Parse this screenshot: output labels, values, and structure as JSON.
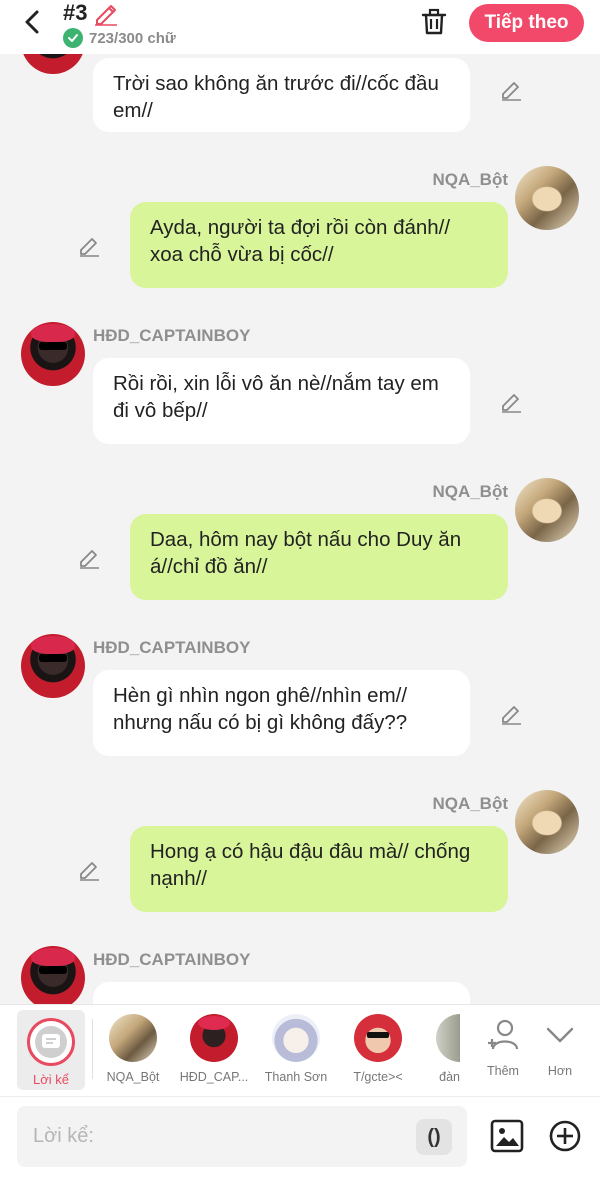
{
  "header": {
    "chapter": "#3",
    "word_count": "723/300 chữ",
    "next_label": "Tiếp theo"
  },
  "messages": [
    {
      "side": "left",
      "name": "",
      "text": "Trời sao không ăn trước đi//cốc đầu em//"
    },
    {
      "side": "right",
      "name": "NQA_Bột",
      "text": "Ayda, người ta đợi rồi còn đánh// xoa chỗ vừa bị cốc//"
    },
    {
      "side": "left",
      "name": "HĐD_CAPTAINBOY",
      "text": "Rồi rồi, xin lỗi vô ăn nè//nắm tay em đi vô bếp//"
    },
    {
      "side": "right",
      "name": "NQA_Bột",
      "text": "Daa, hôm nay bột nấu cho Duy ăn á//chỉ đồ ăn//"
    },
    {
      "side": "left",
      "name": "HĐD_CAPTAINBOY",
      "text": "Hèn gì nhìn ngon ghê//nhìn em// nhưng nấu có bị gì không đấy??"
    },
    {
      "side": "right",
      "name": "NQA_Bột",
      "text": "Hong ạ có hậu đậu đâu mà// chống nạnh//"
    },
    {
      "side": "left",
      "name": "HĐD_CAPTAINBOY",
      "text": ""
    }
  ],
  "charbar": {
    "narration_label": "Lời kể",
    "characters": [
      {
        "label": "NQA_Bột",
        "avatar": "nqa"
      },
      {
        "label": "HĐD_CAP...",
        "avatar": "hdd"
      },
      {
        "label": "Thanh Sơn",
        "avatar": "ts"
      },
      {
        "label": "T/gcte><",
        "avatar": "tg"
      },
      {
        "label": "đàn",
        "avatar": "dan"
      }
    ],
    "add_label": "Thêm",
    "more_label": "Hơn"
  },
  "input": {
    "placeholder": "Lời kể:",
    "paren_label": "()"
  },
  "colors": {
    "accent": "#f2496a",
    "bubble_right": "#d8f59a",
    "bubble_left": "#ffffff",
    "background": "#f3f3f3"
  }
}
